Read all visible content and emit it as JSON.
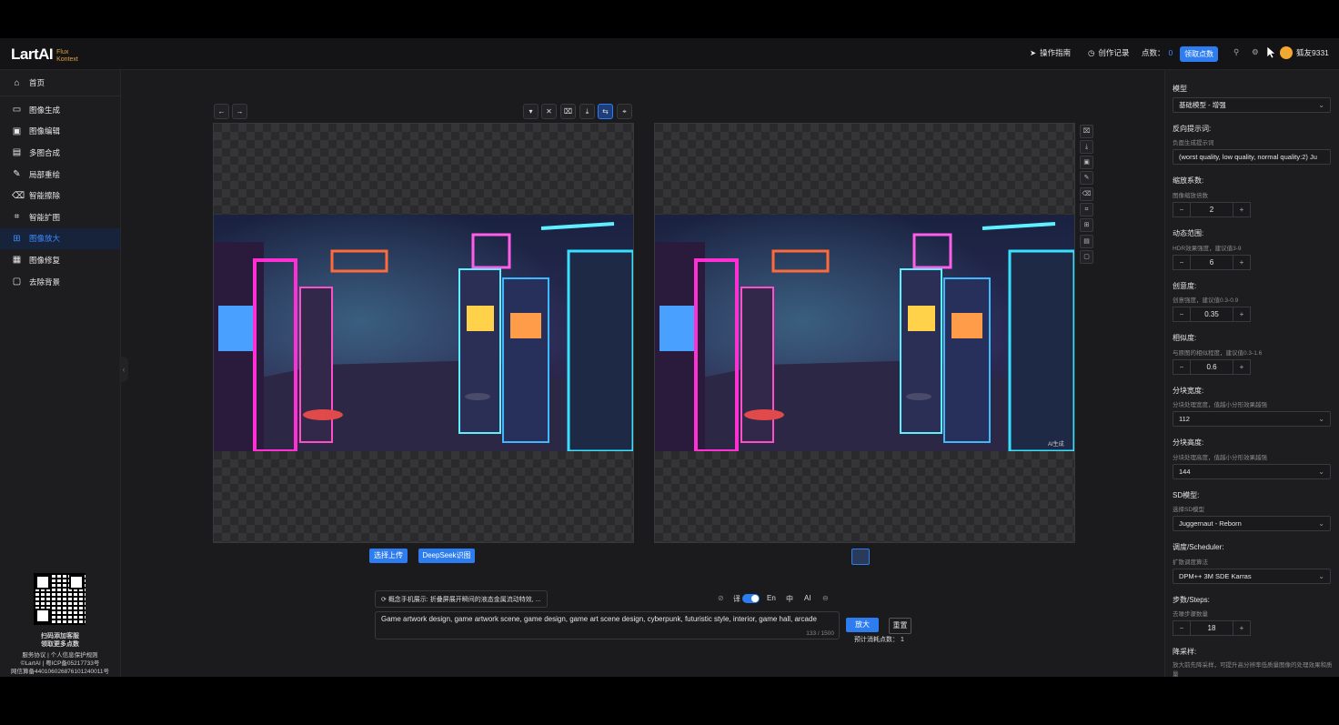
{
  "brand": {
    "logo": "LartAI",
    "sub1": "Flux",
    "sub2": "Kontext"
  },
  "header": {
    "guide": "操作指南",
    "history": "创作记录",
    "points_label": "点数：",
    "points_value": "0",
    "claim": "领取点数",
    "username": "狐友9331"
  },
  "sidebar": {
    "home": "首页",
    "items": [
      {
        "label": "图像生成",
        "icon": "chat-icon"
      },
      {
        "label": "图像编辑",
        "icon": "image-edit-icon"
      },
      {
        "label": "多图合成",
        "icon": "multi-image-icon"
      },
      {
        "label": "局部重绘",
        "icon": "pencil-icon"
      },
      {
        "label": "智能擦除",
        "icon": "eraser-icon"
      },
      {
        "label": "智能扩图",
        "icon": "crop-icon"
      },
      {
        "label": "图像放大",
        "icon": "upscale-icon"
      },
      {
        "label": "图像修复",
        "icon": "repair-icon"
      },
      {
        "label": "去除背景",
        "icon": "remove-bg-icon"
      }
    ],
    "active": "图像放大",
    "footer": {
      "qr_title": "扫码添加客服",
      "qr_sub": "领取更多点数",
      "links": "服务协议 | 个人信息保护规则",
      "icp": "©LartAI | 粤ICP备05217733号",
      "police": "网信算备440106026876101240011号"
    }
  },
  "workspace": {
    "upload_btn": "选择上传",
    "deepseek_btn": "DeepSeek识图",
    "suggestion": "概念手机展示: 折叠屏展开瞬间的液态金属流动特效, ...",
    "prompt": "Game artwork design, game artwork scene, game design, game art scene design, cyberpunk, futuristic style, interior, game hall, arcade",
    "counter": "133 / 1500",
    "opt_translate": "译",
    "opt_en": "En",
    "opt_zh": "中",
    "opt_ai": "AI",
    "upscale_btn": "放大",
    "reset_btn": "重置",
    "cost_label": "预计消耗点数：",
    "cost_value": "1",
    "watermark": "AI生成"
  },
  "panel": {
    "model_label": "模型",
    "model_value": "基础模型 - 增强",
    "neg_label": "反向提示词:",
    "neg_desc": "负面生成提示词",
    "neg_value": "(worst quality, low quality, normal quality:2) Ju",
    "scale_label": "缩放系数:",
    "scale_desc": "图像缩放倍数",
    "scale_value": "2",
    "dyn_label": "动态范围:",
    "dyn_desc": "HDR效果强度，建议值3-9",
    "dyn_value": "6",
    "creat_label": "创意度:",
    "creat_desc": "创意强度，建议值0.3-0.9",
    "creat_value": "0.35",
    "sim_label": "相似度:",
    "sim_desc": "与原图的相似程度，建议值0.3-1.6",
    "sim_value": "0.6",
    "tw_label": "分块宽度:",
    "tw_desc": "分块处理宽度，值越小分形效果越强",
    "tw_value": "112",
    "th_label": "分块高度:",
    "th_desc": "分块处理高度，值越小分形效果越强",
    "th_value": "144",
    "sd_label": "SD模型:",
    "sd_desc": "选择SD模型",
    "sd_value": "Juggernaut - Reborn",
    "sch_label": "调度/Scheduler:",
    "sch_desc": "扩散调度算法",
    "sch_value": "DPM++ 3M SDE Karras",
    "steps_label": "步数/Steps:",
    "steps_desc": "去噪步骤数量",
    "steps_value": "18",
    "down_label": "降采样:",
    "down_desc": "放大前先降采样，可提升高分辨率低质量图像的处理效果和质量"
  }
}
